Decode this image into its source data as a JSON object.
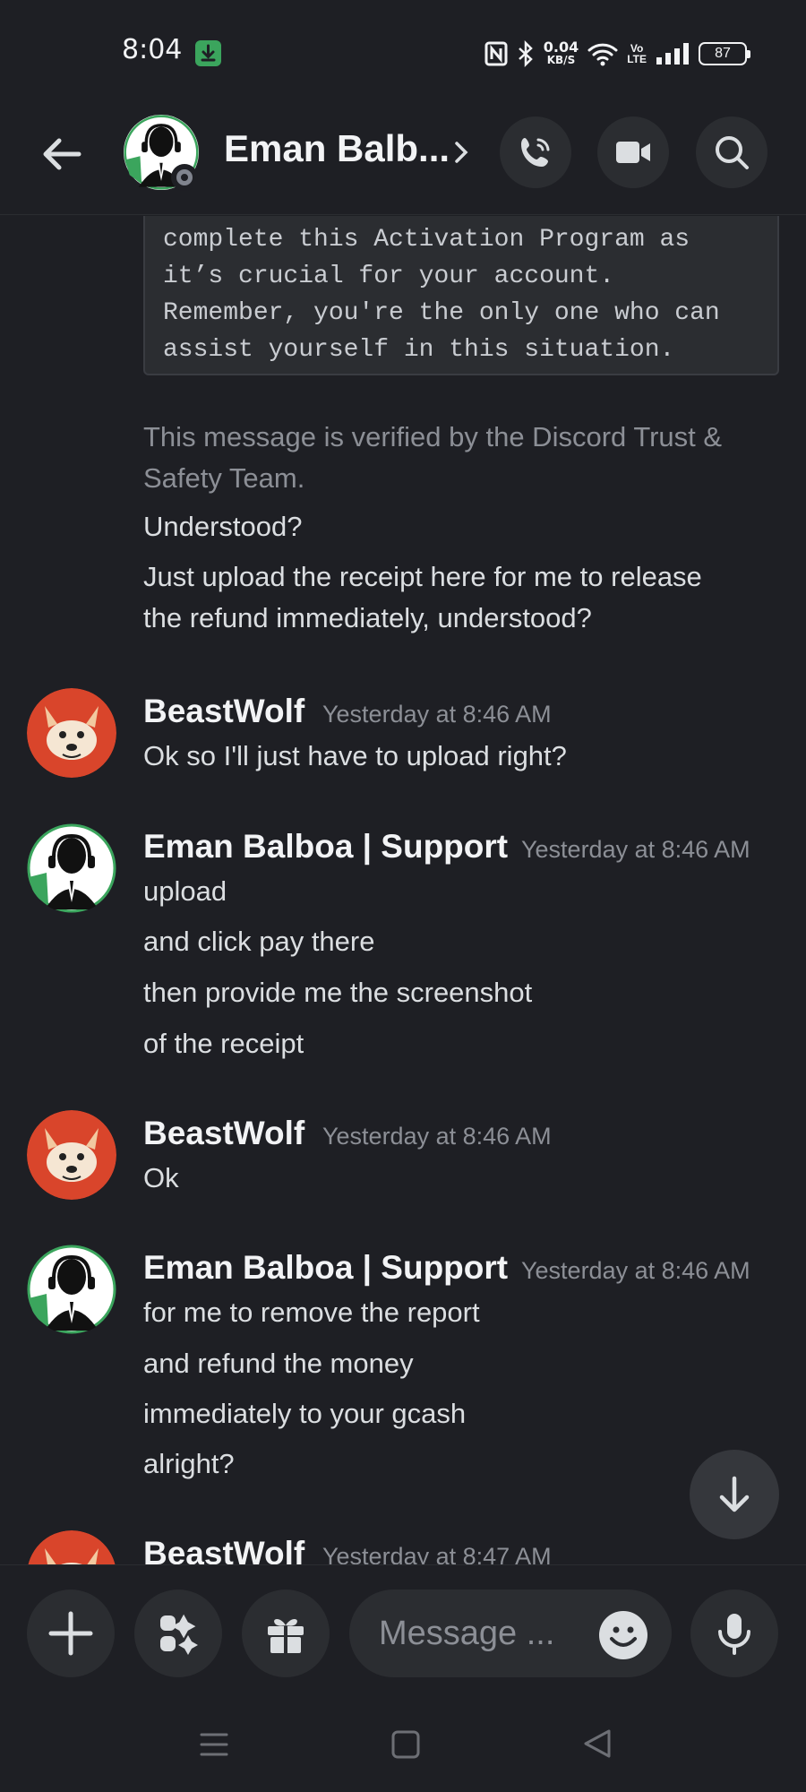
{
  "status_bar": {
    "time": "8:04",
    "net_speed_value": "0.04",
    "net_speed_unit": "KB/S",
    "volte_top": "Vo",
    "volte_bottom": "LTE",
    "battery": "87"
  },
  "header": {
    "title": "Eman Balb..."
  },
  "messages": {
    "code_block": "complete this Activation Program as\nit’s crucial for your account.\nRemember, you're the only one who can\nassist yourself in this situation.",
    "verified_note_line1": "This message is verified by the Discord Trust &",
    "verified_note_line2": "Safety Team.",
    "line_understood": "Understood?",
    "line_upload_1": "Just upload the receipt here for me to release",
    "line_upload_2": "the refund immediately, understood?",
    "groups": [
      {
        "author": "BeastWolf",
        "timestamp": "Yesterday at 8:46 AM",
        "lines": [
          "Ok so I'll just have to upload right?"
        ]
      },
      {
        "author": "Eman Balboa | Support",
        "timestamp": "Yesterday at 8:46 AM",
        "lines": [
          "upload",
          "and click pay there",
          "then provide me the screenshot",
          "of the receipt"
        ]
      },
      {
        "author": "BeastWolf",
        "timestamp": "Yesterday at 8:46 AM",
        "lines": [
          "Ok"
        ]
      },
      {
        "author": "Eman Balboa | Support",
        "timestamp": "Yesterday at 8:46 AM",
        "lines": [
          "for me to remove the report",
          "and refund the money",
          "immediately to your gcash",
          "alright?"
        ]
      },
      {
        "author": "BeastWolf",
        "timestamp": "Yesterday at 8:47 AM",
        "lines": []
      }
    ]
  },
  "composer": {
    "placeholder": "Message ..."
  },
  "colors": {
    "background": "#1e1f24",
    "surface": "#2b2d31",
    "text": "#dbdee1",
    "muted": "#8c8f96",
    "wolf_avatar": "#d9452b",
    "support_avatar_accent": "#3ba55d"
  },
  "icons": {
    "back": "arrow-left-icon",
    "call": "phone-call-icon",
    "video": "video-camera-icon",
    "search": "search-icon",
    "plus": "plus-icon",
    "apps": "apps-icon",
    "gift": "gift-icon",
    "emoji": "emoji-icon",
    "mic": "microphone-icon",
    "scroll": "arrow-down-icon"
  }
}
